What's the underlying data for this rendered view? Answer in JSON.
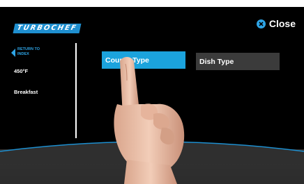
{
  "brand": {
    "logo_text": "TURBOCHEF"
  },
  "header": {
    "close_label": "Close"
  },
  "sidebar": {
    "back_label": "RETURN TO INDEX",
    "temperature": "450°F",
    "meal": "Breakfast"
  },
  "main": {
    "course_type_label": "Course Type",
    "dish_type_label": "Dish Type"
  },
  "colors": {
    "accent": "#1ba3dd",
    "button_inactive": "#3b3b3b",
    "background": "#000000"
  }
}
